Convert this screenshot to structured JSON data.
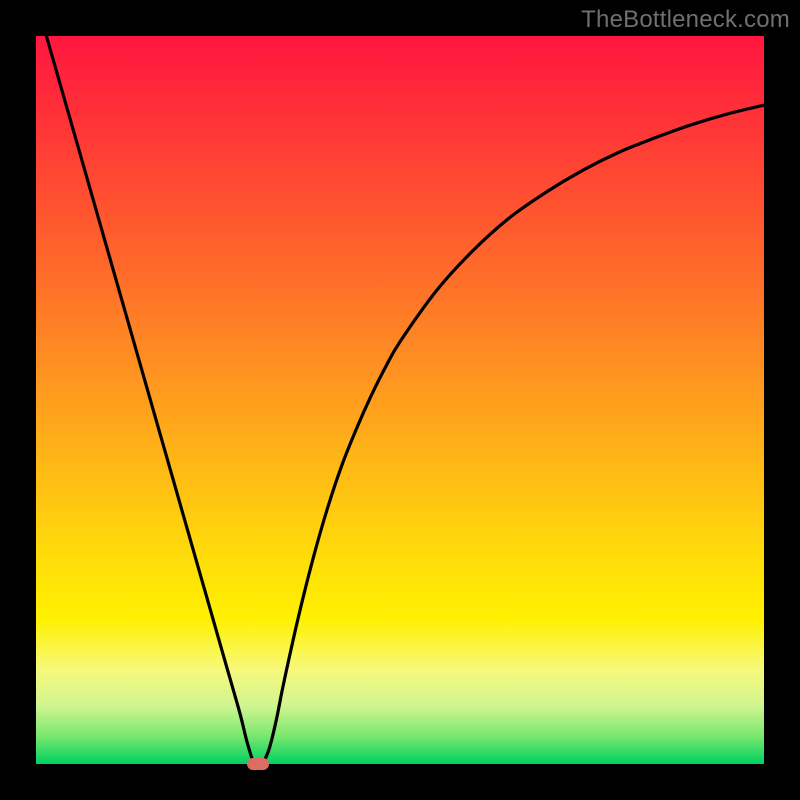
{
  "watermark": "TheBottleneck.com",
  "colors": {
    "curve": "#000000",
    "marker": "#da6e62",
    "frame": "#000000"
  },
  "chart_data": {
    "type": "line",
    "title": "",
    "xlabel": "",
    "ylabel": "",
    "xlim": [
      0,
      100
    ],
    "ylim": [
      0,
      100
    ],
    "curve": {
      "x": [
        0,
        2,
        4,
        6,
        8,
        10,
        12,
        14,
        16,
        18,
        20,
        22,
        24,
        26,
        28,
        29,
        30,
        31,
        32,
        33,
        34,
        36,
        38,
        40,
        42,
        44,
        46,
        48,
        50,
        55,
        60,
        65,
        70,
        75,
        80,
        85,
        90,
        95,
        100
      ],
      "y": [
        105,
        98,
        91,
        84,
        77,
        70,
        63,
        56,
        49,
        42,
        35,
        28,
        21,
        14,
        7,
        3,
        0,
        0,
        2,
        6,
        11,
        20,
        28,
        35,
        41,
        46,
        50.5,
        54.5,
        58,
        65,
        70.5,
        75,
        78.5,
        81.5,
        84,
        86,
        87.8,
        89.3,
        90.5
      ]
    },
    "marker": {
      "x": 30.5,
      "y": 0
    },
    "background_gradient": {
      "orientation": "vertical",
      "stops": [
        {
          "pos": 0,
          "color": "#ff173f"
        },
        {
          "pos": 50,
          "color": "#ffb516"
        },
        {
          "pos": 80,
          "color": "#fff000"
        },
        {
          "pos": 100,
          "color": "#00d060"
        }
      ]
    }
  }
}
